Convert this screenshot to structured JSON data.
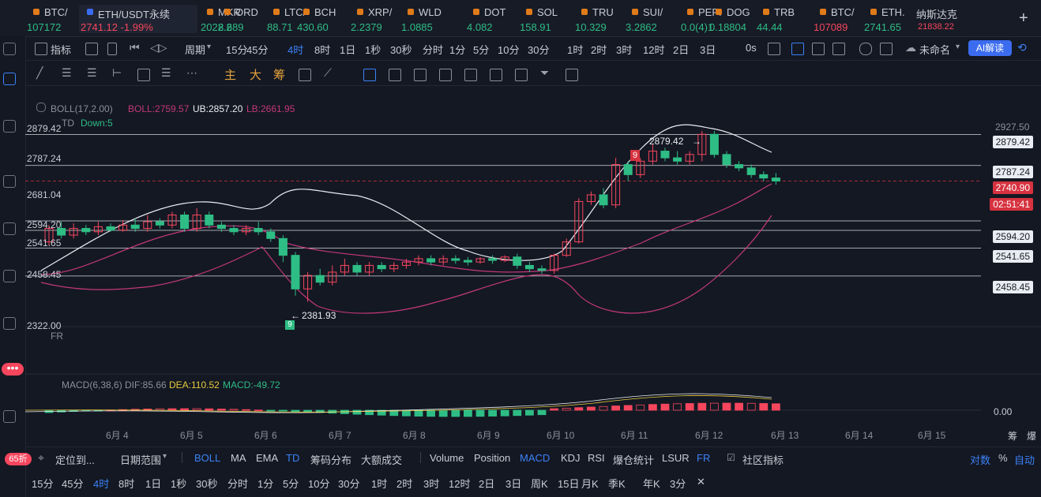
{
  "ticker": [
    {
      "name": "BTC/",
      "price": "107172",
      "dir": "up"
    },
    {
      "name": "ETH/USDT永续",
      "price": "2741.12  -1.99%",
      "dir": "dn",
      "selected": true
    },
    {
      "name": "MKR",
      "price": "2022.2",
      "dir": "up"
    },
    {
      "name": "ORD",
      "price": "8.689",
      "dir": "up"
    },
    {
      "name": "LTC/",
      "price": "88.71",
      "dir": "up"
    },
    {
      "name": "BCH",
      "price": "430.60",
      "dir": "up"
    },
    {
      "name": "XRP/",
      "price": "2.2379",
      "dir": "up"
    },
    {
      "name": "WLD",
      "price": "1.0885",
      "dir": "up"
    },
    {
      "name": "DOT",
      "price": "4.082",
      "dir": "up"
    },
    {
      "name": "SOL",
      "price": "158.91",
      "dir": "up"
    },
    {
      "name": "TRU",
      "price": "10.329",
      "dir": "up"
    },
    {
      "name": "SUI/",
      "price": "3.2862",
      "dir": "up"
    },
    {
      "name": "PEPI",
      "price": "0.0(4)1",
      "dir": "up"
    },
    {
      "name": "DOG",
      "price": "0.18804",
      "dir": "up"
    },
    {
      "name": "TRB",
      "price": "44.44",
      "dir": "up"
    },
    {
      "name": "BTC/",
      "price": "107089",
      "dir": "dn"
    },
    {
      "name": "ETH.",
      "price": "2741.65",
      "dir": "up"
    },
    {
      "name": "纳斯达克",
      "price": "21838.22",
      "dir": "dn"
    }
  ],
  "toolbar": {
    "indicator_label": "指标",
    "period_label": "周期",
    "intervals": [
      "15分",
      "45分",
      "4时",
      "8时",
      "1日",
      "1秒",
      "30秒",
      "分时",
      "1分",
      "5分",
      "10分",
      "30分",
      "1时",
      "2时",
      "3时",
      "12时",
      "2日",
      "3日"
    ],
    "active_interval": "4时",
    "countdown": "0s",
    "layout_name": "未命名",
    "ai_label": "AI解读"
  },
  "drawbar": {
    "main": "主",
    "big": "大",
    "chip": "筹"
  },
  "chart": {
    "boll_label": "BOLL(17,2.00)",
    "boll_value": "BOLL:2759.57",
    "ub_value": "UB:2857.20",
    "lb_value": "LB:2661.95",
    "td_label": "TD",
    "td_value": "Down:5",
    "fr_label": "FR",
    "macd_label": "MACD(6,38,6)",
    "dif_value": "DIF:85.66",
    "dea_value": "DEA:110.52",
    "macd_value": "MACD:-49.72",
    "macd_zero": "0.00",
    "high_marker": "2879.42",
    "low_marker": "2381.93",
    "td9_top": "9",
    "td9_bottom": "9",
    "left_levels": [
      "2879.42",
      "2787.24",
      "2681.04",
      "2594.20",
      "2541.65",
      "2458.45",
      "2322.00"
    ],
    "right_scale_top": "2927.50",
    "price_lines": [
      "2879.42",
      "2787.24",
      "2594.20",
      "2541.65",
      "2458.45"
    ],
    "current_price": "2740.90",
    "countdown_box": "02:51:41",
    "x_dates": [
      "6月 4",
      "6月 5",
      "6月 6",
      "6月 7",
      "6月 8",
      "6月 9",
      "6月 10",
      "6月 11",
      "6月 12",
      "6月 13",
      "6月 14",
      "6月 15"
    ],
    "corner_labels": [
      "筹",
      "爆"
    ]
  },
  "bottom1": {
    "discount": "65折",
    "locate": "定位到...",
    "date_range": "日期范围",
    "indicators": [
      "BOLL",
      "MA",
      "EMA",
      "TD",
      "筹码分布",
      "大额成交"
    ],
    "indicators2": [
      "Volume",
      "Position",
      "MACD",
      "KDJ",
      "RSI",
      "爆仓统计",
      "LSUR",
      "FR"
    ],
    "community": "社区指标",
    "log": "对数",
    "pct": "%",
    "auto": "自动"
  },
  "bottom2": {
    "intervals": [
      "15分",
      "45分",
      "4时",
      "8时",
      "1日",
      "1秒",
      "30秒",
      "分时",
      "1分",
      "5分",
      "10分",
      "30分",
      "1时",
      "2时",
      "3时",
      "12时",
      "2日",
      "3日",
      "周K",
      "15日",
      "月K",
      "季K",
      "年K",
      "3分"
    ],
    "active": "4时"
  },
  "colors": {
    "up": "#2ebd85",
    "down": "#f6465d",
    "accent": "#3b82f6",
    "boll_mid": "#c2387a"
  }
}
